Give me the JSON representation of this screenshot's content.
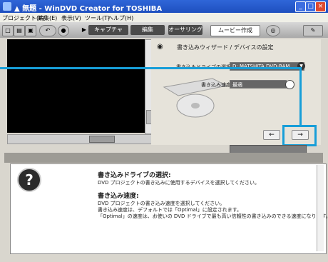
{
  "window": {
    "title": "▲ 無題 - WinDVD Creator for TOSHIBA",
    "controls": [
      "_",
      "□",
      "×"
    ]
  },
  "menu": [
    "プロジェクト(P)",
    "編集(E)",
    "表示(V)",
    "ツール(T)",
    "ヘルプ(H)"
  ],
  "tabs": [
    {
      "label": "キャプチャ",
      "active": false
    },
    {
      "label": "編集",
      "active": false
    },
    {
      "label": "オーサリング",
      "active": false
    },
    {
      "label": "ムービー作成",
      "active": true
    }
  ],
  "wizard": {
    "title": "書き込みウィザード / デバイスの設定",
    "drive_label": "書き込みドライブの選択",
    "drive_value": "D: MATSHITA DVD-RAM",
    "speed_label": "書き込み速度",
    "speed_value": "最適"
  },
  "nav": {
    "back": "←",
    "next": "→"
  },
  "help": {
    "drive_heading": "書き込みドライブの選択:",
    "drive_text": "DVD プロジェクトの書き込みに使用するデバイスを選択してください。",
    "speed_heading": "書き込み速度:",
    "speed_line1": "DVD プロジェクトの書き込み速度を選択してください。",
    "speed_line2": "書き込み速度は、デフォルトでは「Optimal」に設定されます。",
    "speed_line3": "「Optimal」の速度は、お使いの DVD ドライブで最も高い信頼性の書き込みのできる速度になります。"
  },
  "colors": {
    "highlight": "#179ed8",
    "title_bar": "#2f66d8"
  }
}
